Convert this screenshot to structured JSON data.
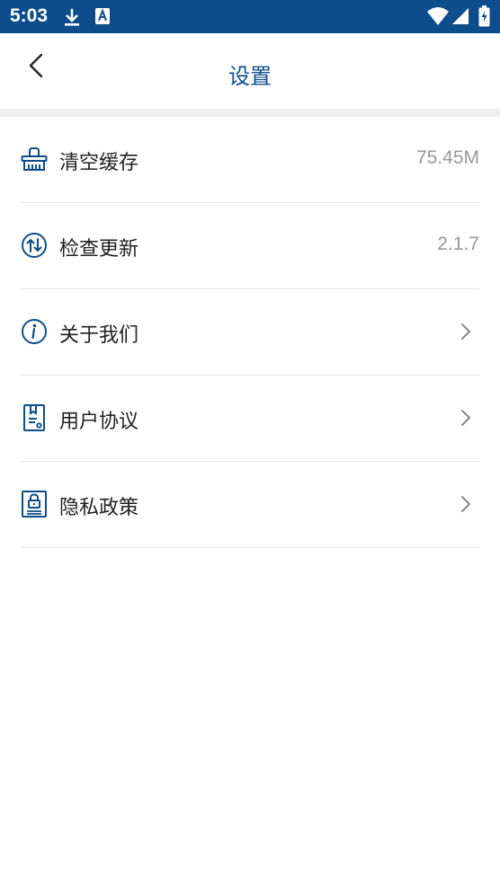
{
  "status_bar": {
    "time": "5:03",
    "bg_color": "#0d4d8c",
    "icons": [
      "download-icon",
      "keyboard-a-icon",
      "wifi-icon",
      "signal-icon",
      "battery-charging-icon"
    ]
  },
  "header": {
    "title": "设置",
    "back_icon": "chevron-left-icon",
    "title_color": "#0d4d8c"
  },
  "settings": {
    "items": [
      {
        "icon": "basket-icon",
        "label": "清空缓存",
        "value": "75.45M"
      },
      {
        "icon": "update-arrows-icon",
        "label": "检查更新",
        "value": "2.1.7"
      },
      {
        "icon": "info-icon",
        "label": "关于我们",
        "action": "chevron-right-icon"
      },
      {
        "icon": "document-icon",
        "label": "用户协议",
        "action": "chevron-right-icon"
      },
      {
        "icon": "privacy-lock-icon",
        "label": "隐私政策",
        "action": "chevron-right-icon"
      }
    ]
  }
}
